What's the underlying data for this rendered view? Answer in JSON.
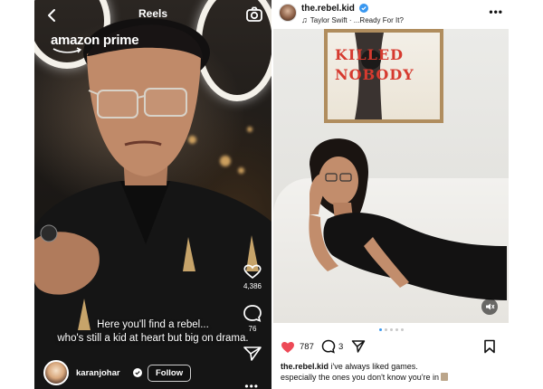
{
  "reel": {
    "header_title": "Reels",
    "brand_logo": "amazon prime",
    "caption_line1": "Here you'll find a rebel...",
    "caption_line2": "who's still a kid at heart but big on drama.",
    "like_count": "4,386",
    "comment_count": "76",
    "username": "karanjohar",
    "follow_label": "Follow",
    "icons": [
      "back-arrow-icon",
      "camera-icon",
      "heart-icon",
      "comment-icon",
      "send-icon",
      "verified-icon",
      "more-icon"
    ]
  },
  "post": {
    "username": "the.rebel.kid",
    "music": "Taylor Swift · ...Ready For It?",
    "artwork_text_line1": "KILLED",
    "artwork_text_line2": "NOBODY",
    "like_count": "787",
    "comment_count": "3",
    "caption_user": "the.rebel.kid",
    "caption_line1": "i've always liked games.",
    "caption_line2": "especially the ones you don't know you're in",
    "carousel": {
      "total": 5,
      "active": 1
    },
    "colors": {
      "like": "#ed4956",
      "carousel_active": "#3897f0",
      "verified": "#3897f0"
    },
    "icons": [
      "verified-icon",
      "music-note-icon",
      "more-icon",
      "mute-icon",
      "heart-filled-icon",
      "comment-icon",
      "share-icon",
      "bookmark-icon"
    ]
  }
}
